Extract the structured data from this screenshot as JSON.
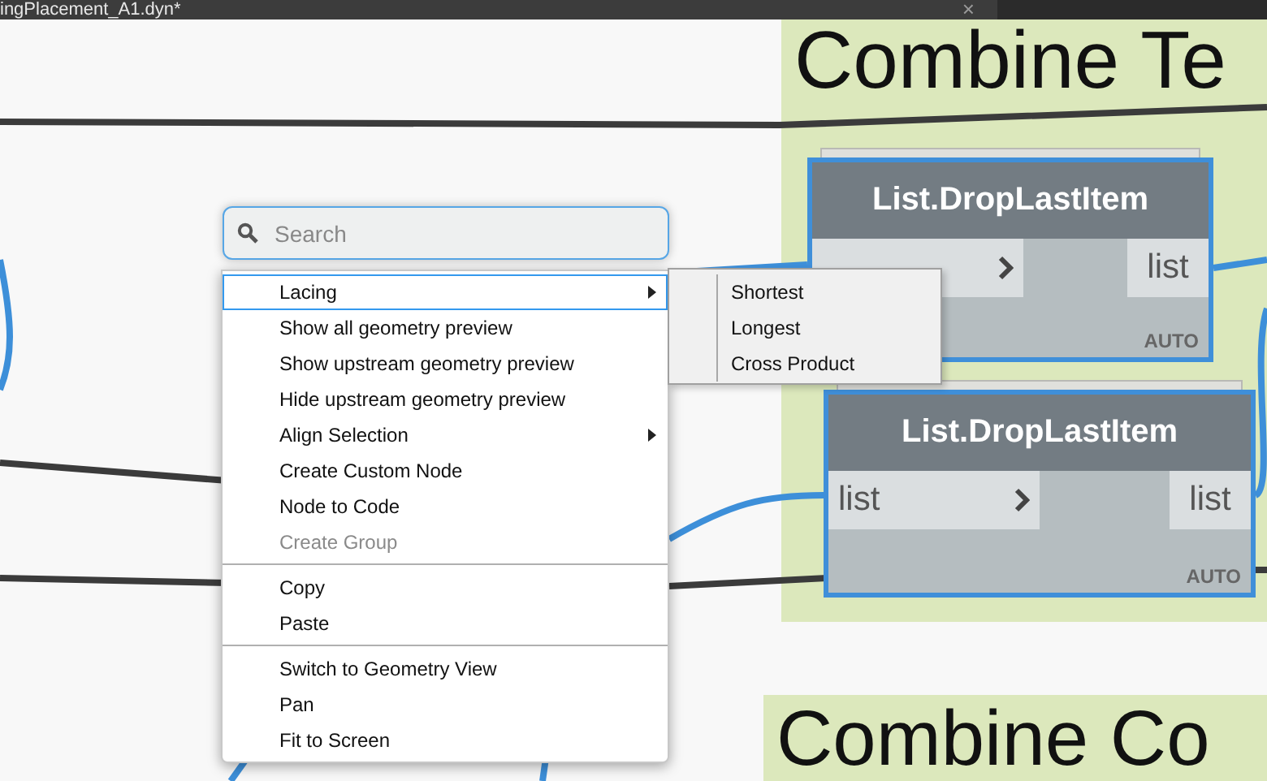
{
  "tab": {
    "title": "ingPlacement_A1.dyn*",
    "close": "×"
  },
  "groups": [
    {
      "title": "Combine Te"
    },
    {
      "title": "Combine Co"
    }
  ],
  "nodes": [
    {
      "title": "List.DropLastItem",
      "output": "list",
      "lacing": "AUTO",
      "selected": true
    },
    {
      "title": "List.DropLastItem",
      "input": "list",
      "output": "list",
      "lacing": "AUTO",
      "selected": true
    }
  ],
  "search": {
    "placeholder": "Search"
  },
  "menu": {
    "sections": [
      {
        "items": [
          {
            "label": "Lacing",
            "submenu": true,
            "selected": true,
            "disabled": false
          },
          {
            "label": "Show all geometry preview",
            "submenu": false,
            "selected": false,
            "disabled": false
          },
          {
            "label": "Show upstream geometry preview",
            "submenu": false,
            "selected": false,
            "disabled": false
          },
          {
            "label": "Hide upstream geometry preview",
            "submenu": false,
            "selected": false,
            "disabled": false
          },
          {
            "label": "Align Selection",
            "submenu": true,
            "selected": false,
            "disabled": false
          },
          {
            "label": "Create Custom Node",
            "submenu": false,
            "selected": false,
            "disabled": false
          },
          {
            "label": "Node to Code",
            "submenu": false,
            "selected": false,
            "disabled": false
          },
          {
            "label": "Create Group",
            "submenu": false,
            "selected": false,
            "disabled": true
          }
        ]
      },
      {
        "items": [
          {
            "label": "Copy",
            "submenu": false,
            "selected": false,
            "disabled": false
          },
          {
            "label": "Paste",
            "submenu": false,
            "selected": false,
            "disabled": false
          }
        ]
      },
      {
        "items": [
          {
            "label": "Switch to Geometry View",
            "submenu": false,
            "selected": false,
            "disabled": false
          },
          {
            "label": "Pan",
            "submenu": false,
            "selected": false,
            "disabled": false
          },
          {
            "label": "Fit to Screen",
            "submenu": false,
            "selected": false,
            "disabled": false
          }
        ]
      }
    ]
  },
  "submenu": {
    "items": [
      "Shortest",
      "Longest",
      "Cross Product"
    ]
  }
}
